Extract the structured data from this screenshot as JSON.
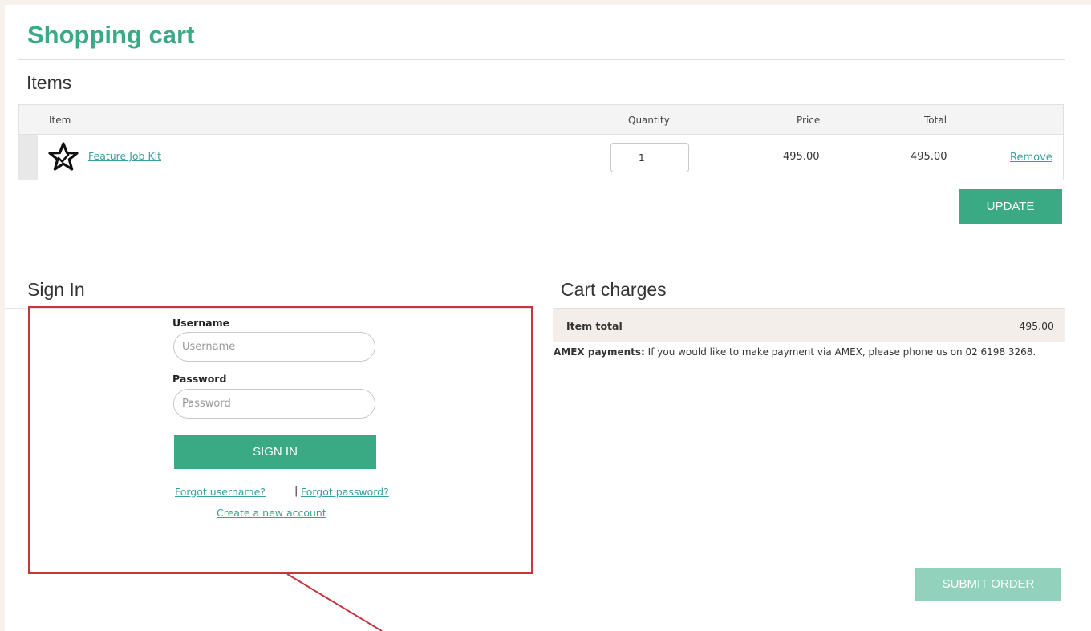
{
  "page": {
    "title": "Shopping cart"
  },
  "items": {
    "heading": "Items",
    "columns": {
      "item": "Item",
      "quantity": "Quantity",
      "price": "Price",
      "total": "Total"
    },
    "rows": [
      {
        "icon": "star-icon",
        "name": "Feature Job Kit",
        "quantity": "1",
        "price": "495.00",
        "total": "495.00",
        "remove_label": "Remove"
      }
    ],
    "update_label": "UPDATE"
  },
  "sign_in": {
    "heading": "Sign In",
    "username_label": "Username",
    "username_placeholder": "Username",
    "password_label": "Password",
    "password_placeholder": "Password",
    "sign_in_label": "SIGN IN",
    "forgot_username": "Forgot username?",
    "separator": "|",
    "forgot_password": "Forgot password?",
    "create_account": "Create a new account"
  },
  "cart_charges": {
    "heading": "Cart charges",
    "item_total_label": "Item total",
    "item_total_value": "495.00",
    "amex_label": "AMEX payments:",
    "amex_text": " If you would like to make payment via AMEX, please phone us on 02 6198 3268.",
    "submit_label": "SUBMIT ORDER"
  },
  "colors": {
    "accent": "#3aaa85",
    "accent_disabled": "#92d2bd",
    "link": "#3a9ea0",
    "annotation": "#c8343f",
    "background": "#f7f1ee"
  }
}
